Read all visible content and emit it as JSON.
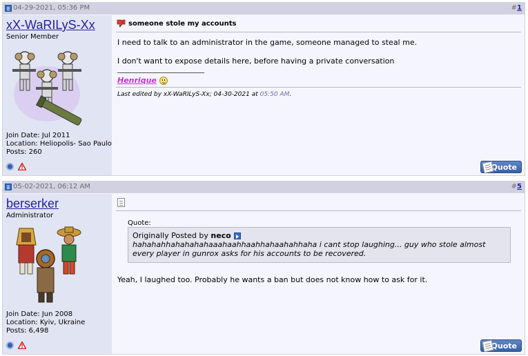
{
  "posts": [
    {
      "date": "04-29-2021, 05:36 PM",
      "number_prefix": "#",
      "number": "1",
      "username": "xX-WaRILyS-Xx",
      "user_title": "Senior Member",
      "join_date": "Join Date: Jul 2011",
      "location": "Location: Heliopolis- Sao Paulo",
      "posts": "Posts: 260",
      "title": "someone stole my accounts",
      "lines": [
        "I need to talk to an administrator in the game, someone managed to steal me.",
        "I don't want to expose details here, before having a private conversation"
      ],
      "signature": "Henrique",
      "edited_prefix": "Last edited by xX-WaRILyS-Xx; 04-30-2021 at ",
      "edited_time": "05:50 AM",
      "edited_suffix": ".",
      "quote_button": "Quote"
    },
    {
      "date": "05-02-2021, 06:12 AM",
      "number_prefix": "#",
      "number": "5",
      "username": "berserker",
      "user_title": "Administrator",
      "join_date": "Join Date: Jun 2008",
      "location": "Location: Kyiv, Ukraine",
      "posts": "Posts: 6,498",
      "quote_label": "Quote:",
      "quote_by_prefix": "Originally Posted by ",
      "quote_author": "neco",
      "quote_text": "hahahahhahahahahaaahaahhaahhahaahahhaha i cant stop laughing... guy who stole almost every player in gunrox asks for his accounts to be recovered.",
      "reply": "Yeah, I laughed too. Probably he wants a ban but does not know how to ask for it.",
      "quote_button": "Quote"
    }
  ],
  "colors": {
    "header_bg": "#d1d1e1",
    "userinfo_bg": "#e1e4f2",
    "post_bg": "#f5f5ff",
    "link": "#22229c",
    "signature": "#cc33cc"
  },
  "icons": [
    "post-icon",
    "online-status-icon",
    "report-post-icon",
    "thumbs-down-icon",
    "smile-icon",
    "quote-icon",
    "document-icon",
    "view-post-icon"
  ]
}
